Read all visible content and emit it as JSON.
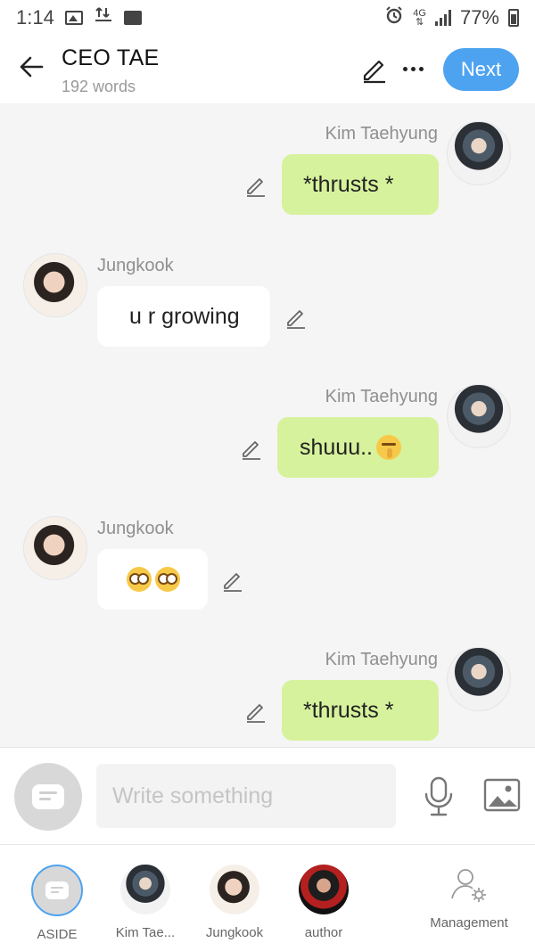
{
  "status_bar": {
    "time": "1:14",
    "network": "4G",
    "battery": "77%"
  },
  "header": {
    "title": "CEO TAE",
    "word_count": "192 words",
    "next_label": "Next"
  },
  "messages": [
    {
      "sender": "Kim Taehyung",
      "side": "right",
      "text": "*thrusts *"
    },
    {
      "sender": "Jungkook",
      "side": "left",
      "text": "u r growing"
    },
    {
      "sender": "Kim Taehyung",
      "side": "right",
      "text": "shuuu..",
      "emoji": "shushing-face"
    },
    {
      "sender": "Jungkook",
      "side": "left",
      "text": "",
      "emoji": "flushed-face x2"
    },
    {
      "sender": "Kim Taehyung",
      "side": "right",
      "text": "*thrusts *"
    }
  ],
  "composer": {
    "placeholder": "Write something"
  },
  "bottom_bar": {
    "items": [
      {
        "label": "ASIDE"
      },
      {
        "label": "Kim Tae..."
      },
      {
        "label": "Jungkook"
      },
      {
        "label": "author"
      },
      {
        "label": "Management"
      }
    ]
  },
  "colors": {
    "accent": "#4da3f0",
    "right_bubble": "#d6f29c",
    "left_bubble": "#ffffff",
    "background": "#f5f5f5"
  }
}
